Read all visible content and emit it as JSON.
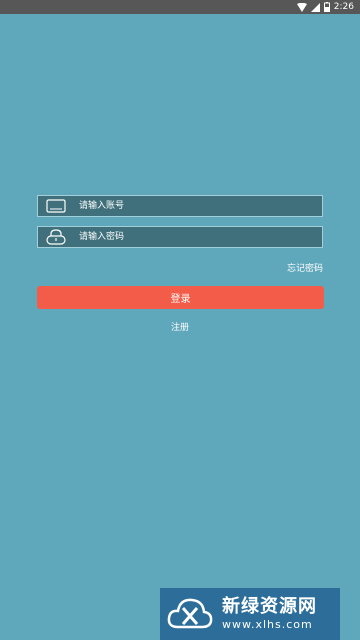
{
  "status_bar": {
    "time": "2:26",
    "icons": [
      "wifi-icon",
      "signal-icon",
      "battery-icon"
    ]
  },
  "login_form": {
    "account_placeholder": "请输入账号",
    "account_value": "",
    "account_icon": "account-icon",
    "password_placeholder": "请输入密码",
    "password_value": "",
    "password_icon": "lock-icon",
    "forgot_password": "忘记密码",
    "login_label": "登录",
    "register_label": "注册"
  },
  "watermark": {
    "title": "新绿资源网",
    "url": "www.xlhs.com",
    "logo_icon": "cloud-logo-icon"
  },
  "colors": {
    "background": "#5fa8bb",
    "status_bar": "#575757",
    "input_fill": "#3f707b",
    "input_border": "#a2cfda",
    "login_button": "#f35c48",
    "watermark_bg": "#2c6e99"
  }
}
